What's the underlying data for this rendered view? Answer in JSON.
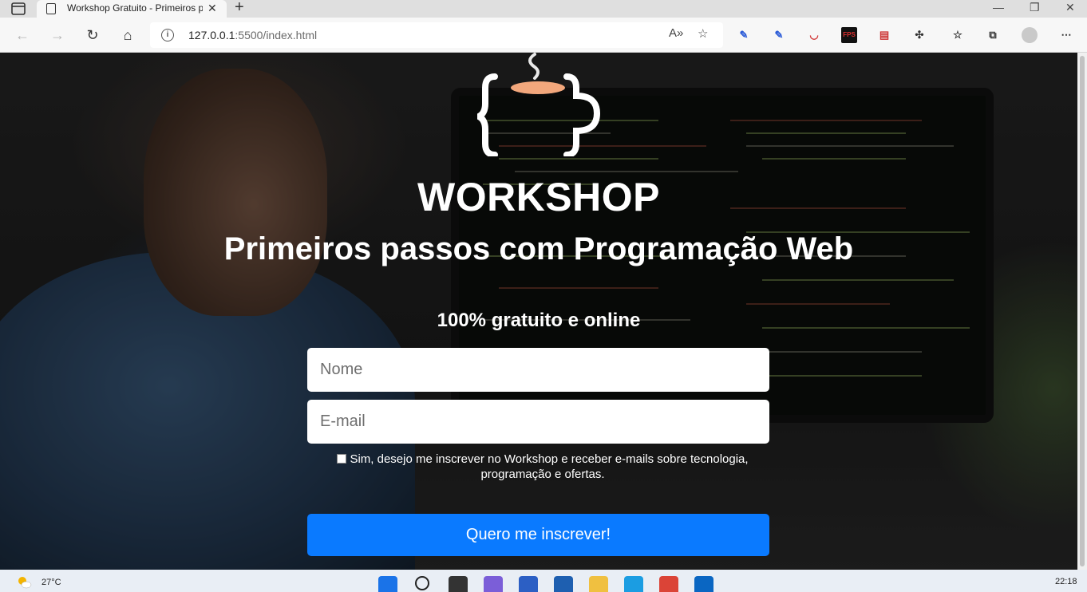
{
  "browser": {
    "tab_title": "Workshop Gratuito - Primeiros p",
    "url_host": "127.0.0.1",
    "url_rest": ":5500/index.html",
    "extensions": [
      "bookmark-pen-icon",
      "bookmark-pen-icon",
      "pocket-icon",
      "fps-icon",
      "pdf-icon",
      "puzzle-icon"
    ]
  },
  "page": {
    "title": "WORKSHOP",
    "subtitle": "Primeiros passos com Programação Web",
    "tagline": "100% gratuito e online",
    "name_placeholder": "Nome",
    "email_placeholder": "E-mail",
    "consent_line1": "Sim, desejo me inscrever no Workshop e receber e-mails sobre tecnologia,",
    "consent_line2": "programação e ofertas.",
    "submit_label": "Quero me inscrever!"
  },
  "taskbar": {
    "temperature": "27°C",
    "time": "22:18"
  },
  "colors": {
    "accent": "#0a7aff",
    "logo_cup": "#f2a77c"
  }
}
